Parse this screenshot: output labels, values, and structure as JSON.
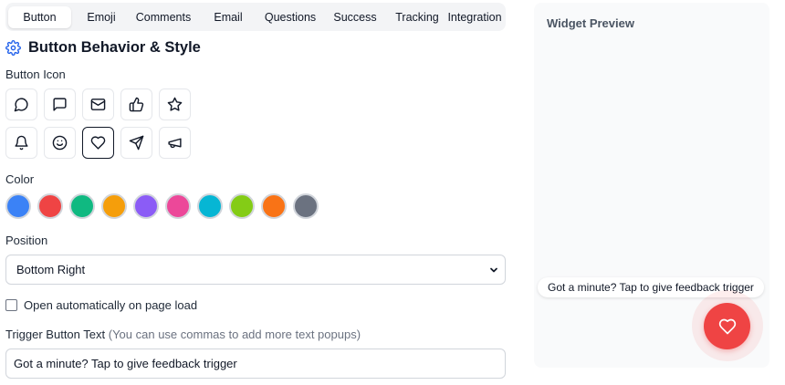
{
  "tabs": [
    {
      "label": "Button",
      "active": true
    },
    {
      "label": "Emoji",
      "active": false
    },
    {
      "label": "Comments",
      "active": false
    },
    {
      "label": "Email",
      "active": false
    },
    {
      "label": "Questions",
      "active": false
    },
    {
      "label": "Success",
      "active": false
    },
    {
      "label": "Tracking",
      "active": false
    },
    {
      "label": "Integration",
      "active": false
    }
  ],
  "section": {
    "title": "Button Behavior & Style",
    "icon": "gear-icon"
  },
  "button_icon": {
    "label": "Button Icon",
    "icons": [
      "message-circle-icon",
      "message-square-icon",
      "mail-icon",
      "thumbs-up-icon",
      "star-icon",
      "bell-icon",
      "smile-icon",
      "heart-icon",
      "send-icon",
      "megaphone-icon"
    ],
    "selected": "heart-icon"
  },
  "color": {
    "label": "Color",
    "swatches": [
      "#3b82f6",
      "#ef4444",
      "#10b981",
      "#f59e0b",
      "#8b5cf6",
      "#ec4899",
      "#06b6d4",
      "#84cc16",
      "#f97316",
      "#6b7280"
    ],
    "selected": "#ef4444"
  },
  "position": {
    "label": "Position",
    "value": "Bottom Right"
  },
  "auto_open": {
    "label": "Open automatically on page load",
    "checked": false
  },
  "trigger": {
    "label": "Trigger Button Text",
    "hint": "(You can use commas to add more text popups)",
    "value": "Got a minute? Tap to give feedback trigger"
  },
  "preview": {
    "title": "Widget Preview",
    "bubble_text": "Got a minute? Tap to give feedback trigger",
    "button_color": "#ef4444",
    "button_icon": "heart-icon"
  }
}
